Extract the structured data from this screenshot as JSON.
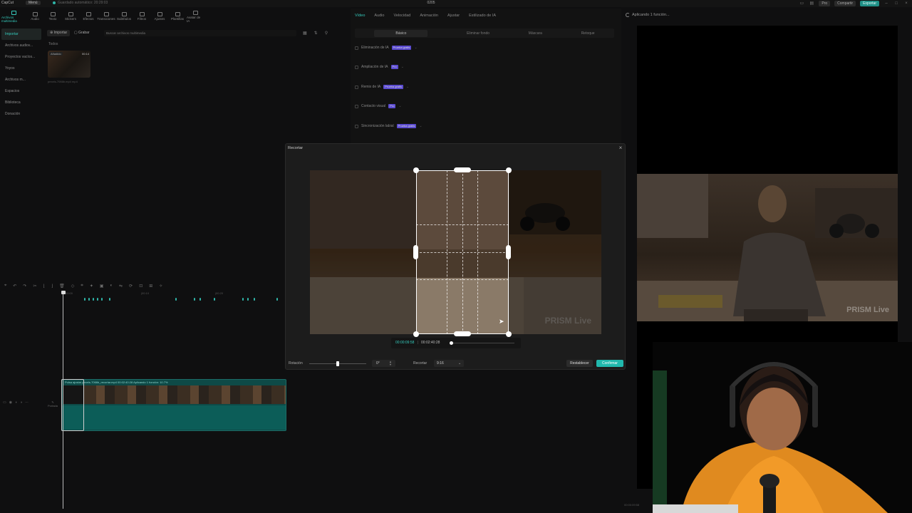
{
  "titlebar": {
    "logo": "CapCut",
    "menu": "Menú",
    "saved": "Guardado automático: 20:29:03",
    "project": "0205",
    "pro": "Pro",
    "share": "Compartir",
    "export": "Exportar"
  },
  "toolbar": [
    {
      "label": "Archivos multimedia",
      "icon": "media-icon",
      "active": true
    },
    {
      "label": "Audio",
      "icon": "audio-icon"
    },
    {
      "label": "Texto",
      "icon": "text-icon"
    },
    {
      "label": "Stickers",
      "icon": "sticker-icon"
    },
    {
      "label": "Efectos",
      "icon": "effects-icon"
    },
    {
      "label": "Transiciones",
      "icon": "transition-icon"
    },
    {
      "label": "Subtítulos",
      "icon": "subtitles-icon"
    },
    {
      "label": "Filtros",
      "icon": "filter-icon"
    },
    {
      "label": "Ajustes",
      "icon": "adjust-icon"
    },
    {
      "label": "Plantillas",
      "icon": "template-icon"
    },
    {
      "label": "Avatar de IA",
      "icon": "avatar-icon"
    }
  ],
  "sidebar": {
    "items": [
      {
        "label": "Importar",
        "active": true
      },
      {
        "label": "Archivos audiov..."
      },
      {
        "label": "Proyectos vacíos..."
      },
      {
        "label": "Yoyos"
      },
      {
        "label": "Archivos m..."
      },
      {
        "label": "Espacios"
      },
      {
        "label": "Biblioteca"
      },
      {
        "label": "Donación"
      }
    ]
  },
  "media": {
    "import_label": "Importar",
    "record_label": "Grabar",
    "search_placeholder": "Buscar archivos multimedia",
    "section_label": "Todos",
    "thumb_badge": "Añadido",
    "thumb_duration": "00:14",
    "thumb_name": "pexels-7066b.mp4 mp4"
  },
  "props": {
    "tabs": [
      {
        "label": "Vídeo",
        "active": true
      },
      {
        "label": "Audio"
      },
      {
        "label": "Velocidad"
      },
      {
        "label": "Animación"
      },
      {
        "label": "Ajustar"
      },
      {
        "label": "Estilizado de IA"
      }
    ],
    "subtabs": [
      {
        "label": "Básico",
        "active": true
      },
      {
        "label": "Eliminar fondo"
      },
      {
        "label": "Máscara"
      },
      {
        "label": "Retoque"
      }
    ],
    "features": [
      {
        "label": "Eliminación de IA",
        "tag": "Prueba gratis"
      },
      {
        "label": "Ampliación de IA",
        "tag": "Pro"
      },
      {
        "label": "Remix de IA",
        "tag": "Prueba gratis"
      },
      {
        "label": "Contacto visual",
        "tag": "Pro"
      },
      {
        "label": "Sincronización labial",
        "tag": "Prueba gratis"
      }
    ]
  },
  "player": {
    "status": "Aplicando 1 función..."
  },
  "timeline": {
    "ruler": [
      "00:00",
      "|00:10",
      "|00:20"
    ],
    "clip_label": "Pulsa ajustar  pexels-7066b_recortar.mp4  00:02:40:28  Aplicando 1 función: 10.7%",
    "cover_label": "Portada",
    "bottom_time": "00:00:09:58"
  },
  "crop_dialog": {
    "title": "Recortar",
    "current_time": "00:00:09:58",
    "separator": "|",
    "total_time": "00:02:40:28",
    "playback_progress": 0.02,
    "rotation_label": "Rotación",
    "rotation_value": "0°",
    "rotation_slider": 0.5,
    "crop_label": "Recortar",
    "ratio_value": "9:16",
    "reset_label": "Restablecer",
    "confirm_label": "Confirmar",
    "watermark": "PRISM Live"
  },
  "colors": {
    "accent": "#35c9bb",
    "confirm": "#21b8ad",
    "pro_tag": "#5b4bd1"
  }
}
